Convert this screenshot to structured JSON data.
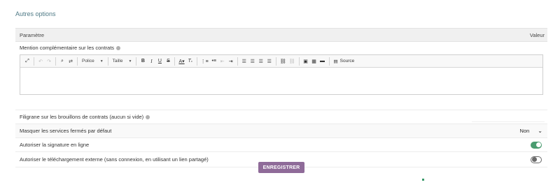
{
  "section": {
    "title": "Autres options"
  },
  "table": {
    "header_param": "Paramètre",
    "header_value": "Valeur"
  },
  "mention": {
    "label": "Mention complémentaire sur les contrats",
    "toolbar": {
      "font_label": "Police",
      "size_label": "Taille",
      "source_label": "Source"
    }
  },
  "watermark": {
    "label": "Filigrane sur les brouillons de contrats (aucun si vide)",
    "value": ""
  },
  "hide_closed": {
    "label": "Masquer les services fermés par défaut",
    "value": "Non"
  },
  "online_signature": {
    "label": "Autoriser la signature en ligne",
    "enabled": true
  },
  "external_download": {
    "label": "Autoriser le téléchargement externe (sans connexion, en utilisant un lien partagé)",
    "enabled": false
  },
  "save_label": "ENREGISTRER",
  "colors": {
    "accent": "#8f6b99",
    "toggle_on": "#4a9c70",
    "title": "#4f7a86"
  }
}
